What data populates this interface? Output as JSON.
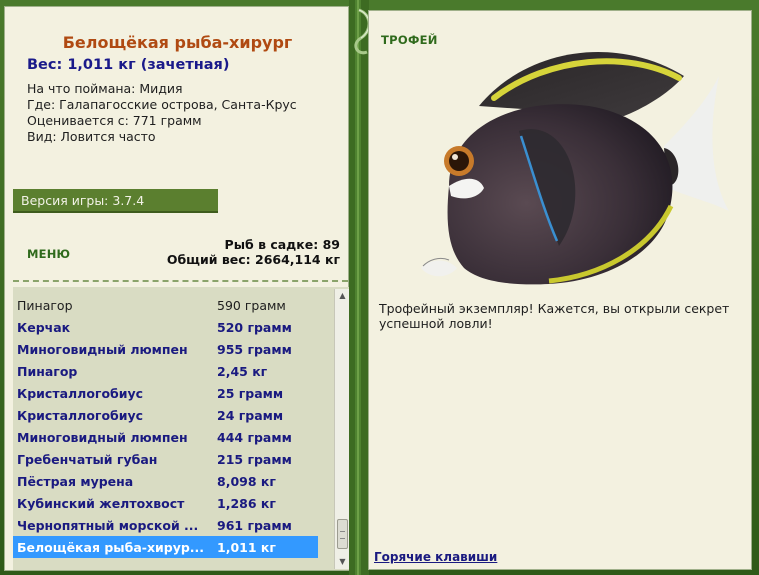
{
  "fish_card": {
    "title": "Белощёкая рыба-хирург",
    "weight": "Вес: 1,011 кг (зачетная)",
    "caught_on": "На что поймана: Мидия",
    "location": "Где: Галапагосские острова, Санта-Крус",
    "valued_from": "Оценивается с: 771 грамм",
    "frequency": "Вид: Ловится часто"
  },
  "version": "Версия игры: 3.7.4",
  "menu_label": "МЕНЮ",
  "stats": {
    "fish_count": "Рыб в садке: 89",
    "total_weight": "Общий вес: 2664,114 кг"
  },
  "catch_list": [
    {
      "name": "Пинагор",
      "weight": "590 грамм",
      "style": "plain"
    },
    {
      "name": "Керчак",
      "weight": "520 грамм",
      "style": "bold"
    },
    {
      "name": "Миноговидный люмпен",
      "weight": "955 грамм",
      "style": "bold"
    },
    {
      "name": "Пинагор",
      "weight": "2,45 кг",
      "style": "bold"
    },
    {
      "name": "Кристаллогобиус",
      "weight": "25 грамм",
      "style": "bold"
    },
    {
      "name": "Кристаллогобиус",
      "weight": "24 грамм",
      "style": "bold"
    },
    {
      "name": "Миноговидный люмпен",
      "weight": "444 грамм",
      "style": "bold"
    },
    {
      "name": "Гребенчатый губан",
      "weight": "215 грамм",
      "style": "bold"
    },
    {
      "name": "Пёстрая мурена",
      "weight": "8,098 кг",
      "style": "bold"
    },
    {
      "name": "Кубинский желтохвост",
      "weight": "1,286 кг",
      "style": "bold"
    },
    {
      "name": "Чернопятный морской ...",
      "weight": "961 грамм",
      "style": "bold"
    },
    {
      "name": "Белощёкая рыба-хирур...",
      "weight": "1,011 кг",
      "style": "selected"
    }
  ],
  "trophy": {
    "label": "ТРОФЕЙ",
    "text": "Трофейный экземпляр! Кажется, вы открыли секрет успешной ловли!"
  },
  "hotkeys_label": "Горячие клавиши",
  "colors": {
    "panel_bg": "#f3f1e0",
    "frame_green": "#3d6b22",
    "title_orange": "#b04a12",
    "link_blue": "#1a1a80",
    "selection_blue": "#3399ff",
    "list_bg": "#d9dcc3"
  }
}
